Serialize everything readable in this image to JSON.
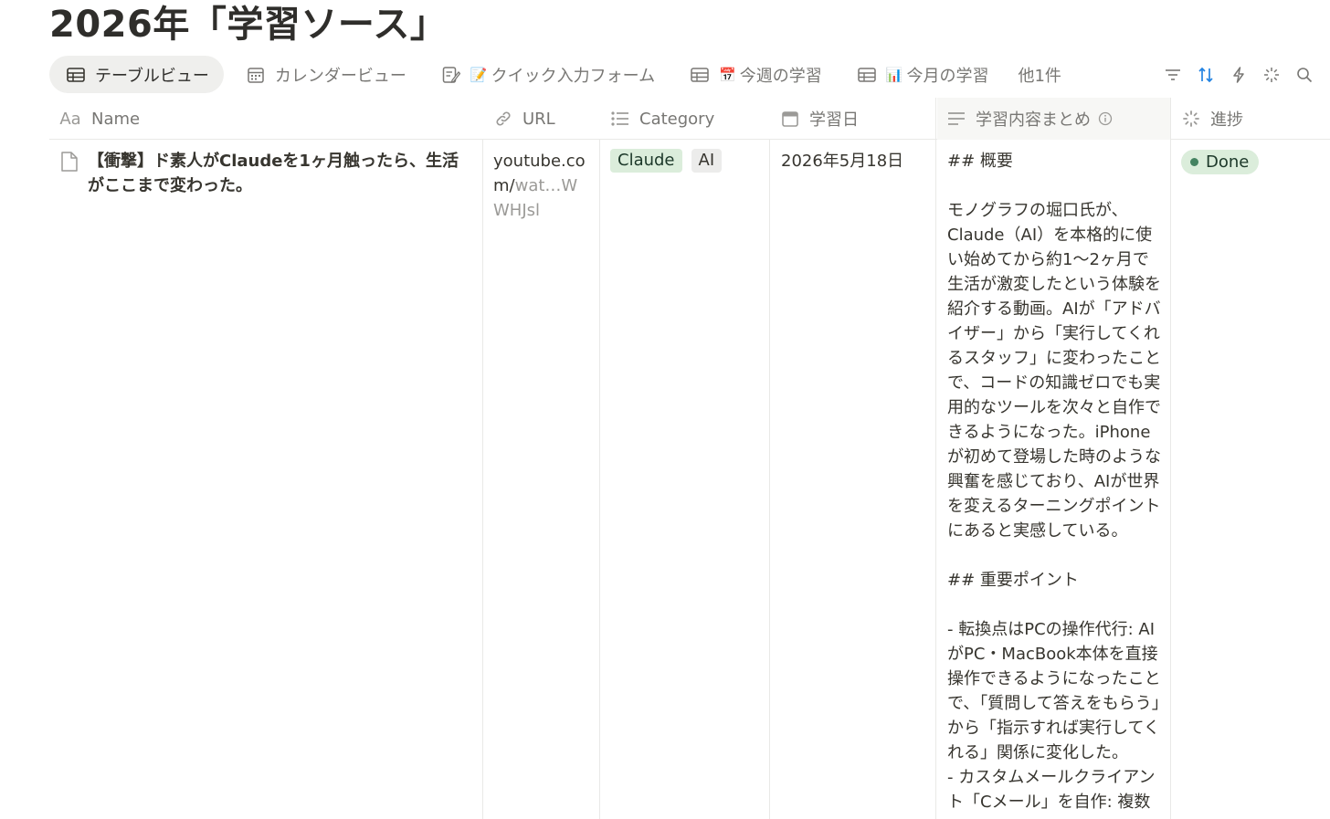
{
  "page": {
    "title": "2026年「学習ソース」"
  },
  "tabs": [
    {
      "label": "テーブルビュー",
      "icon": "table-icon",
      "active": true
    },
    {
      "label": "カレンダービュー",
      "icon": "calendar-icon"
    },
    {
      "label": "クイック入力フォーム",
      "icon": "form-icon",
      "emoji": "📝"
    },
    {
      "label": "今週の学習",
      "icon": "table-icon",
      "emoji": "📅"
    },
    {
      "label": "今月の学習",
      "icon": "table-icon",
      "emoji": "📊"
    }
  ],
  "more_views": "他1件",
  "toolbar": [
    "filter-icon",
    "sort-icon",
    "automation-icon",
    "customize-icon",
    "search-icon"
  ],
  "columns": {
    "name": "Name",
    "url": "URL",
    "category": "Category",
    "date": "学習日",
    "summary": "学習内容まとめ",
    "status": "進捗"
  },
  "rows": [
    {
      "name": "【衝撃】ド素人がClaudeを1ヶ月触ったら、生活がここまで変わった。",
      "url_main": "youtube.com/",
      "url_dim": "wat…WWHJsl",
      "categories": [
        "Claude",
        "AI"
      ],
      "date": "2026年5月18日",
      "summary": [
        "## 概要",
        "",
        "モノグラフの堀口氏が、Claude（AI）を本格的に使い始めてから約1〜2ヶ月で生活が激変したという体験を紹介する動画。AIが「アドバイザー」から「実行してくれるスタッフ」に変わったことで、コードの知識ゼロでも実用的なツールを次々と自作できるようになった。iPhoneが初めて登場した時のような興奮を感じており、AIが世界を変えるターニングポイントにあると実感している。",
        "",
        "## 重要ポイント",
        "",
        "- 転換点はPCの操作代行: AIがPC・MacBook本体を直接操作できるようになったことで、「質問して答えをもらう」から「指示すれば実行してくれる」関係に変化した。",
        "- カスタムメールクライアント「Cメール」を自作: 複数"
      ],
      "status": "Done"
    }
  ],
  "colors": {
    "tag_green_bg": "#dbeddb",
    "tag_gray_bg": "#ececeb",
    "status_dot": "#448361",
    "sort_accent": "#2383e2"
  }
}
